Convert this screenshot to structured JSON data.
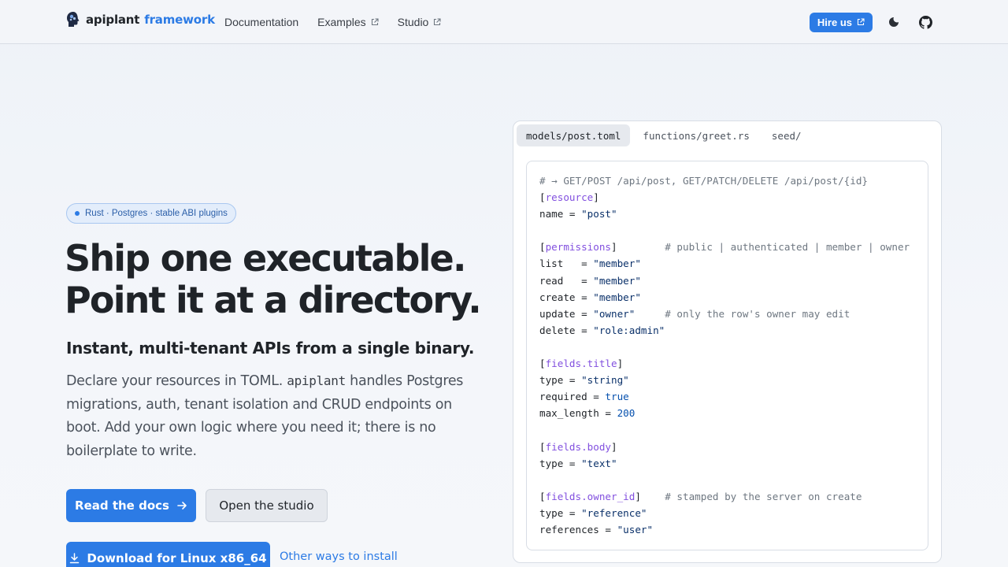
{
  "nav": {
    "brand_name": "apiplant",
    "brand_accent": "framework",
    "links": [
      {
        "label": "Documentation",
        "external": false
      },
      {
        "label": "Examples",
        "external": true
      },
      {
        "label": "Studio",
        "external": true
      }
    ],
    "hire_label": "Hire us"
  },
  "hero": {
    "badge": "Rust · Postgres · stable ABI plugins",
    "title_line1": "Ship one executable.",
    "title_line2": "Point it at a directory.",
    "subtitle": "Instant, multi-tenant APIs from a single binary.",
    "lead_before": "Declare your resources in TOML. ",
    "lead_code": "apiplant",
    "lead_after": " handles Postgres migrations, auth, tenant isolation and CRUD endpoints on boot. Add your own logic where you need it; there is no boilerplate to write.",
    "primary_button": "Read the docs",
    "secondary_button": "Open the studio",
    "download_button": "Download for Linux x86_64",
    "other_link": "Other ways to install"
  },
  "code_panel": {
    "tabs": [
      "models/post.toml",
      "functions/greet.rs",
      "seed/"
    ],
    "active_tab": 0,
    "lines": [
      [
        [
          "c",
          "# → GET/POST /api/post, GET/PATCH/DELETE /api/post/{id}"
        ]
      ],
      [
        [
          "p",
          "["
        ],
        [
          "k",
          "resource"
        ],
        [
          "p",
          "]"
        ]
      ],
      [
        [
          "p",
          "name = "
        ],
        [
          "s",
          "\"post\""
        ]
      ],
      [],
      [
        [
          "p",
          "["
        ],
        [
          "k",
          "permissions"
        ],
        [
          "p",
          "]        "
        ],
        [
          "c",
          "# public | authenticated | member | owner"
        ]
      ],
      [
        [
          "p",
          "list   = "
        ],
        [
          "s",
          "\"member\""
        ]
      ],
      [
        [
          "p",
          "read   = "
        ],
        [
          "s",
          "\"member\""
        ]
      ],
      [
        [
          "p",
          "create = "
        ],
        [
          "s",
          "\"member\""
        ]
      ],
      [
        [
          "p",
          "update = "
        ],
        [
          "s",
          "\"owner\""
        ],
        [
          "p",
          "     "
        ],
        [
          "c",
          "# only the row's owner may edit"
        ]
      ],
      [
        [
          "p",
          "delete = "
        ],
        [
          "s",
          "\"role:admin\""
        ]
      ],
      [],
      [
        [
          "p",
          "["
        ],
        [
          "k",
          "fields.title"
        ],
        [
          "p",
          "]"
        ]
      ],
      [
        [
          "p",
          "type = "
        ],
        [
          "s",
          "\"string\""
        ]
      ],
      [
        [
          "p",
          "required = "
        ],
        [
          "n",
          "true"
        ]
      ],
      [
        [
          "p",
          "max_length = "
        ],
        [
          "n",
          "200"
        ]
      ],
      [],
      [
        [
          "p",
          "["
        ],
        [
          "k",
          "fields.body"
        ],
        [
          "p",
          "]"
        ]
      ],
      [
        [
          "p",
          "type = "
        ],
        [
          "s",
          "\"text\""
        ]
      ],
      [],
      [
        [
          "p",
          "["
        ],
        [
          "k",
          "fields.owner_id"
        ],
        [
          "p",
          "]    "
        ],
        [
          "c",
          "# stamped by the server on create"
        ]
      ],
      [
        [
          "p",
          "type = "
        ],
        [
          "s",
          "\"reference\""
        ]
      ],
      [
        [
          "p",
          "references = "
        ],
        [
          "s",
          "\"user\""
        ]
      ]
    ]
  },
  "colors": {
    "accent": "#2c7be5",
    "text": "#1f2328",
    "muted": "#4b525c"
  }
}
